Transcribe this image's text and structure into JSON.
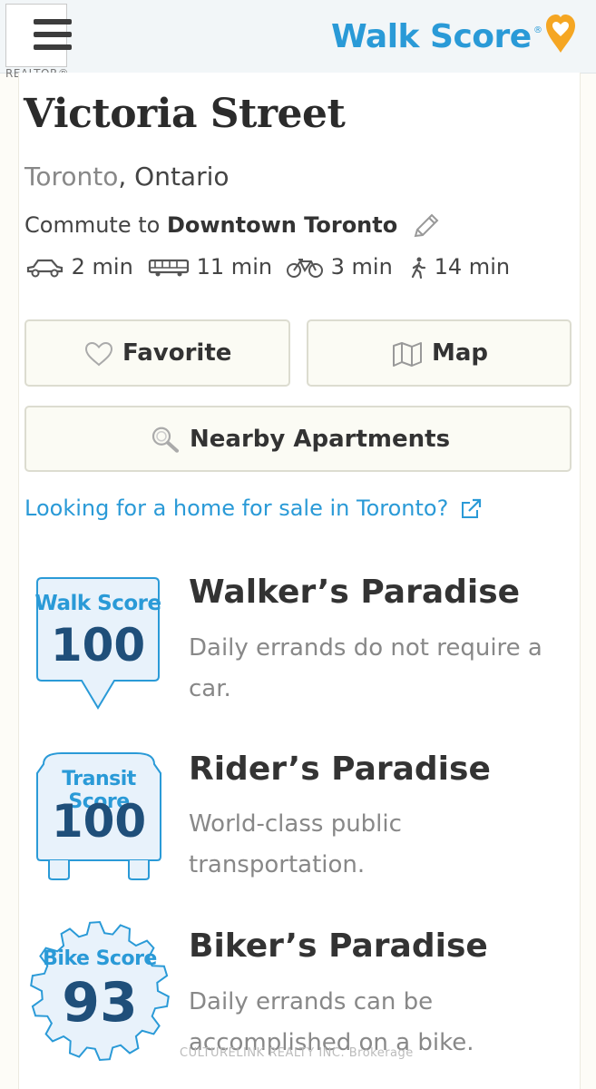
{
  "header": {
    "realtor_label": "REALTOR®",
    "brand": "Walk Score",
    "brand_reg": "®"
  },
  "colors": {
    "accent": "#2a9ad7",
    "score_number": "#1f4f7a",
    "pin": "#f5a623"
  },
  "property": {
    "title": "Victoria Street",
    "city": "Toronto",
    "region": ", Ontario"
  },
  "commute": {
    "prefix": "Commute to ",
    "destination": "Downtown Toronto",
    "modes": [
      {
        "icon": "car-icon",
        "time": "2 min"
      },
      {
        "icon": "bus-icon",
        "time": "11 min"
      },
      {
        "icon": "bike-icon",
        "time": "3 min"
      },
      {
        "icon": "walk-icon",
        "time": "14 min"
      }
    ]
  },
  "buttons": {
    "favorite": "Favorite",
    "map": "Map",
    "nearby": "Nearby Apartments"
  },
  "home_link": "Looking for a home for sale in Toronto?",
  "scores": [
    {
      "badge_label": "Walk Score",
      "value": "100",
      "heading": "Walker’s Paradise",
      "description": "Daily errands do not require a car."
    },
    {
      "badge_label": "Transit Score",
      "value": "100",
      "heading": "Rider’s Paradise",
      "description": "World-class public transportation."
    },
    {
      "badge_label": "Bike Score",
      "value": "93",
      "heading": "Biker’s Paradise",
      "description": "Daily errands can be accomplished on a bike."
    }
  ],
  "watermark": "CULTURELINK REALTY INC. Brokerage"
}
